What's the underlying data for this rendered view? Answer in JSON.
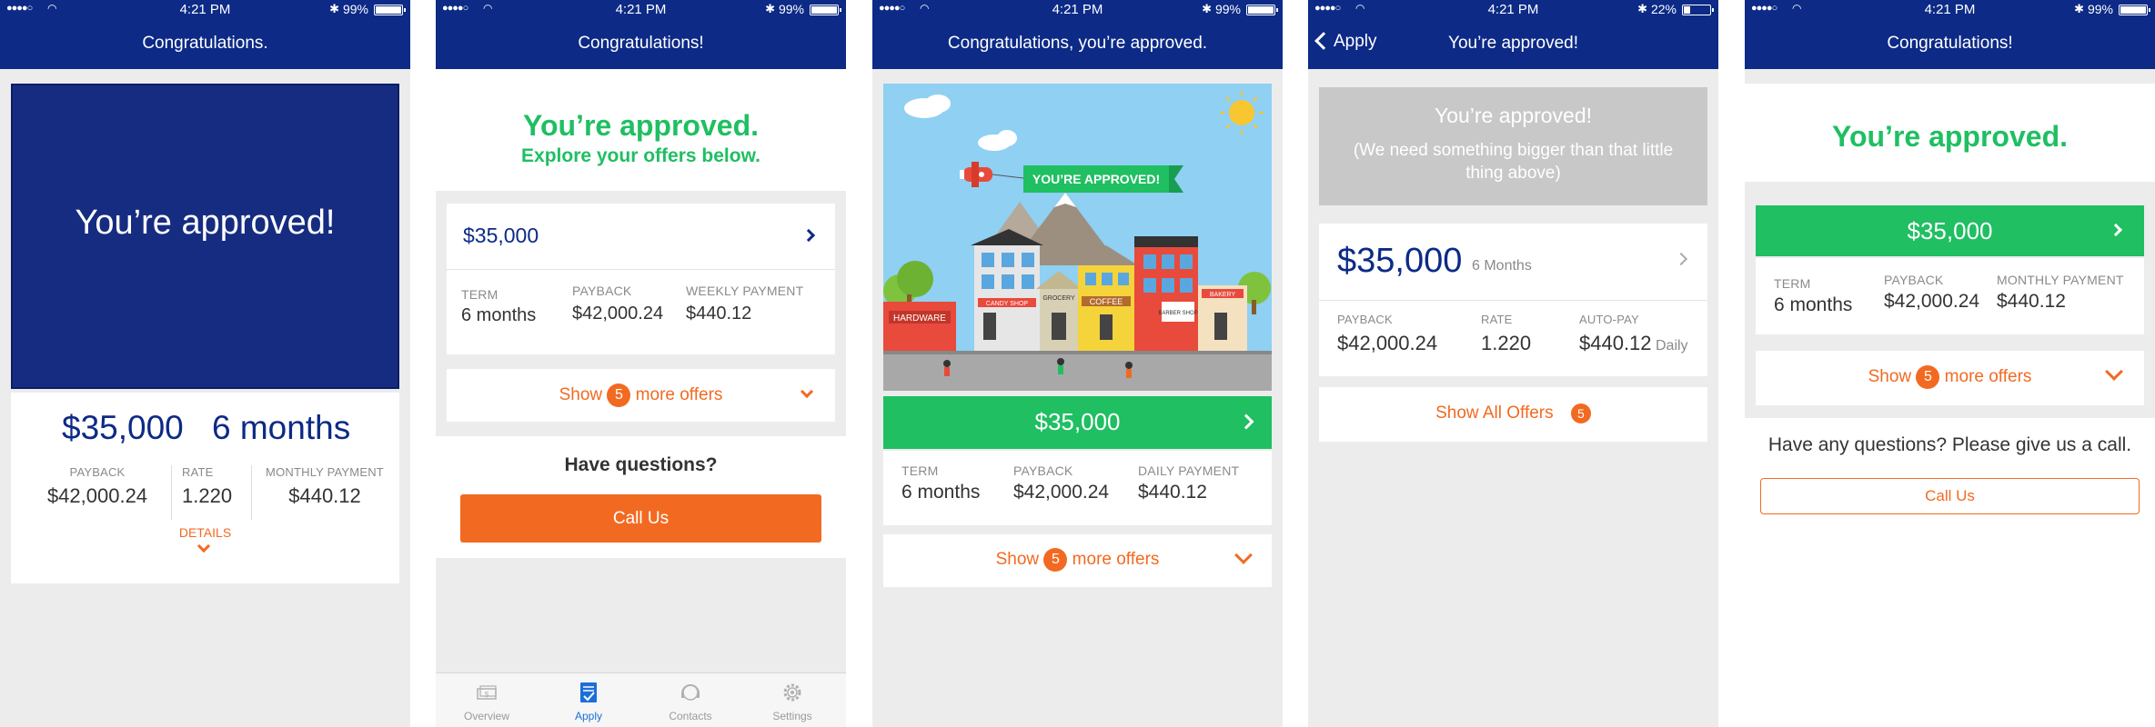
{
  "status": {
    "time": "4:21 PM",
    "battery_full": "99%",
    "battery_low": "22%"
  },
  "s1": {
    "nav_title": "Congratulations.",
    "hero_text": "You’re approved!",
    "amount": "$35,000",
    "term": "6 months",
    "cols": [
      {
        "label": "PAYBACK",
        "value": "$42,000.24"
      },
      {
        "label": "RATE",
        "value": "1.220"
      },
      {
        "label": "MONTHLY PAYMENT",
        "value": "$440.12"
      }
    ],
    "details": "DETAILS"
  },
  "s2": {
    "nav_title": "Congratulations!",
    "headline": "You’re approved.",
    "subhead": "Explore your offers below.",
    "offer_amount": "$35,000",
    "cols": [
      {
        "label": "TERM",
        "value": "6 months"
      },
      {
        "label": "PAYBACK",
        "value": "$42,000.24"
      },
      {
        "label": "WEEKLY PAYMENT",
        "value": "$440.12"
      }
    ],
    "more_pre": "Show",
    "more_count": "5",
    "more_post": "more offers",
    "questions": "Have questions?",
    "call": "Call Us",
    "tabs": [
      {
        "label": "Overview",
        "icon": "money-icon"
      },
      {
        "label": "Apply",
        "icon": "clipboard-check-icon"
      },
      {
        "label": "Contacts",
        "icon": "headset-icon"
      },
      {
        "label": "Settings",
        "icon": "gear-icon"
      }
    ]
  },
  "s3": {
    "nav_title": "Congratulations, you’re approved.",
    "banner": "YOU’RE APPROVED!",
    "signs": {
      "hardware": "HARDWARE",
      "candy": "CANDY SHOP",
      "grocery": "GROCERY",
      "coffee": "COFFEE",
      "bakery": "BAKERY",
      "barber": "BARBER SHOP"
    },
    "amount": "$35,000",
    "cols": [
      {
        "label": "TERM",
        "value": "6 months"
      },
      {
        "label": "PAYBACK",
        "value": "$42,000.24"
      },
      {
        "label": "DAILY PAYMENT",
        "value": "$440.12"
      }
    ],
    "more_pre": "Show",
    "more_count": "5",
    "more_post": "more offers"
  },
  "s4": {
    "back_label": "Apply",
    "nav_title": "You’re approved!",
    "gray_title": "You’re approved!",
    "gray_note": "(We need something bigger than that little thing above)",
    "amount": "$35,000",
    "term": "6 Months",
    "cols": [
      {
        "label": "PAYBACK",
        "value": "$42,000.24"
      },
      {
        "label": "RATE",
        "value": "1.220"
      },
      {
        "label": "AUTO-PAY",
        "value": "$440.12"
      }
    ],
    "daily": "Daily",
    "show_all": "Show All Offers",
    "count": "5"
  },
  "s5": {
    "nav_title": "Congratulations!",
    "headline": "You’re approved.",
    "amount": "$35,000",
    "cols": [
      {
        "label": "TERM",
        "value": "6 months"
      },
      {
        "label": "PAYBACK",
        "value": "$42,000.24"
      },
      {
        "label": "MONTHLY PAYMENT",
        "value": "$440.12"
      }
    ],
    "more_pre": "Show",
    "more_count": "5",
    "more_post": "more offers",
    "questions": "Have any questions? Please give us a call.",
    "call": "Call Us"
  },
  "colors": {
    "navy": "#0c2a86",
    "orange": "#f26a21",
    "green": "#1fbf62",
    "background": "#ececec"
  }
}
